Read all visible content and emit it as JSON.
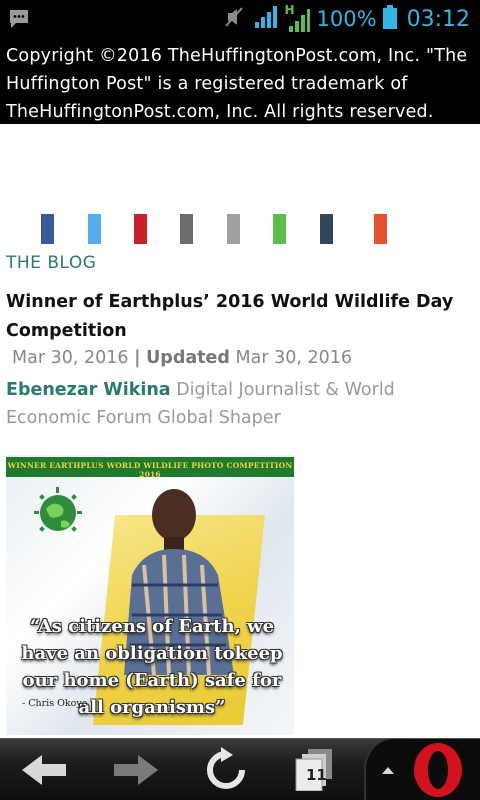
{
  "statusbar": {
    "battery": "100%",
    "time": "03:12",
    "network_label": "H"
  },
  "copyright": {
    "text": "Copyright ©2016 TheHuffingtonPost.com, Inc. \"The Huffington Post\" is a registered trademark of TheHuffingtonPost.com, Inc. All rights reserved."
  },
  "share_bar": {
    "items": [
      {
        "name": "facebook",
        "color": "#3b5998"
      },
      {
        "name": "twitter",
        "color": "#55acee"
      },
      {
        "name": "pinterest",
        "color": "#cb2027"
      },
      {
        "name": "email",
        "color": "#6d6d6d"
      },
      {
        "name": "comment",
        "color": "#a0a0a0"
      },
      {
        "name": "whatsapp",
        "color": "#5cbe4a"
      },
      {
        "name": "tumblr",
        "color": "#35465c"
      },
      {
        "name": "reddit",
        "color": "#e5512e"
      }
    ]
  },
  "article": {
    "section": "THE BLOG",
    "headline": "Winner of Earthplus’ 2016 World Wildlife Day Competition",
    "published": "Mar 30, 2016",
    "separator": "|",
    "updated_label": "Updated",
    "updated": "Mar 30, 2016",
    "author": "Ebenezar Wikina",
    "author_bio": "Digital Journalist & World Economic Forum Global Shaper",
    "image": {
      "banner": "WINNER EARTHPLUS WORLD WILDLIFE PHOTO COMPETITION 2016",
      "quote": "“As citizens of Earth, we have an obligation tokeep our home (Earth) safe for all organisms”",
      "attribution": "- Chris Okoye"
    }
  },
  "bottombar": {
    "tab_count": "11"
  }
}
